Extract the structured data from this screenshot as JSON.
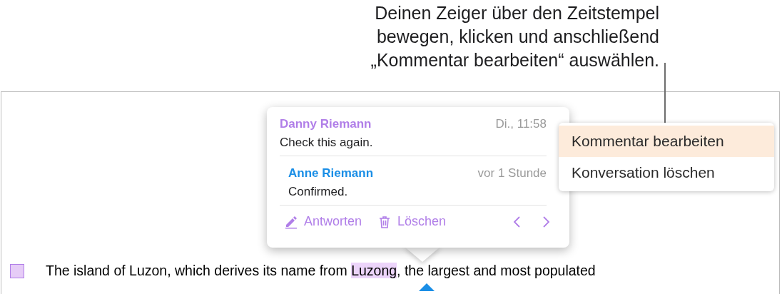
{
  "callout": {
    "text": "Deinen Zeiger über den Zeitstempel\nbewegen, klicken und anschließend\n„Kommentar bearbeiten“ auswählen."
  },
  "document": {
    "text_before": "The island of Luzon, which derives its name from ",
    "highlight": "Luzong",
    "text_after": ", the largest and most populated"
  },
  "comment_popover": {
    "comments": [
      {
        "kind": "comment",
        "author": "Danny Riemann",
        "color": "#b07ee8",
        "time": "Di., 11:58",
        "text": "Check this again."
      },
      {
        "kind": "reply",
        "author": "Anne Riemann",
        "color": "#1a8ee6",
        "time": "vor 1 Stunde",
        "text": "Confirmed."
      }
    ],
    "actions": [
      {
        "kind": "reply",
        "label": "Antworten"
      },
      {
        "kind": "delete",
        "label": "Löschen"
      }
    ]
  },
  "context_menu": {
    "items": [
      {
        "label": "Kommentar bearbeiten",
        "selected": true
      },
      {
        "label": "Konversation löschen",
        "selected": false
      }
    ]
  }
}
